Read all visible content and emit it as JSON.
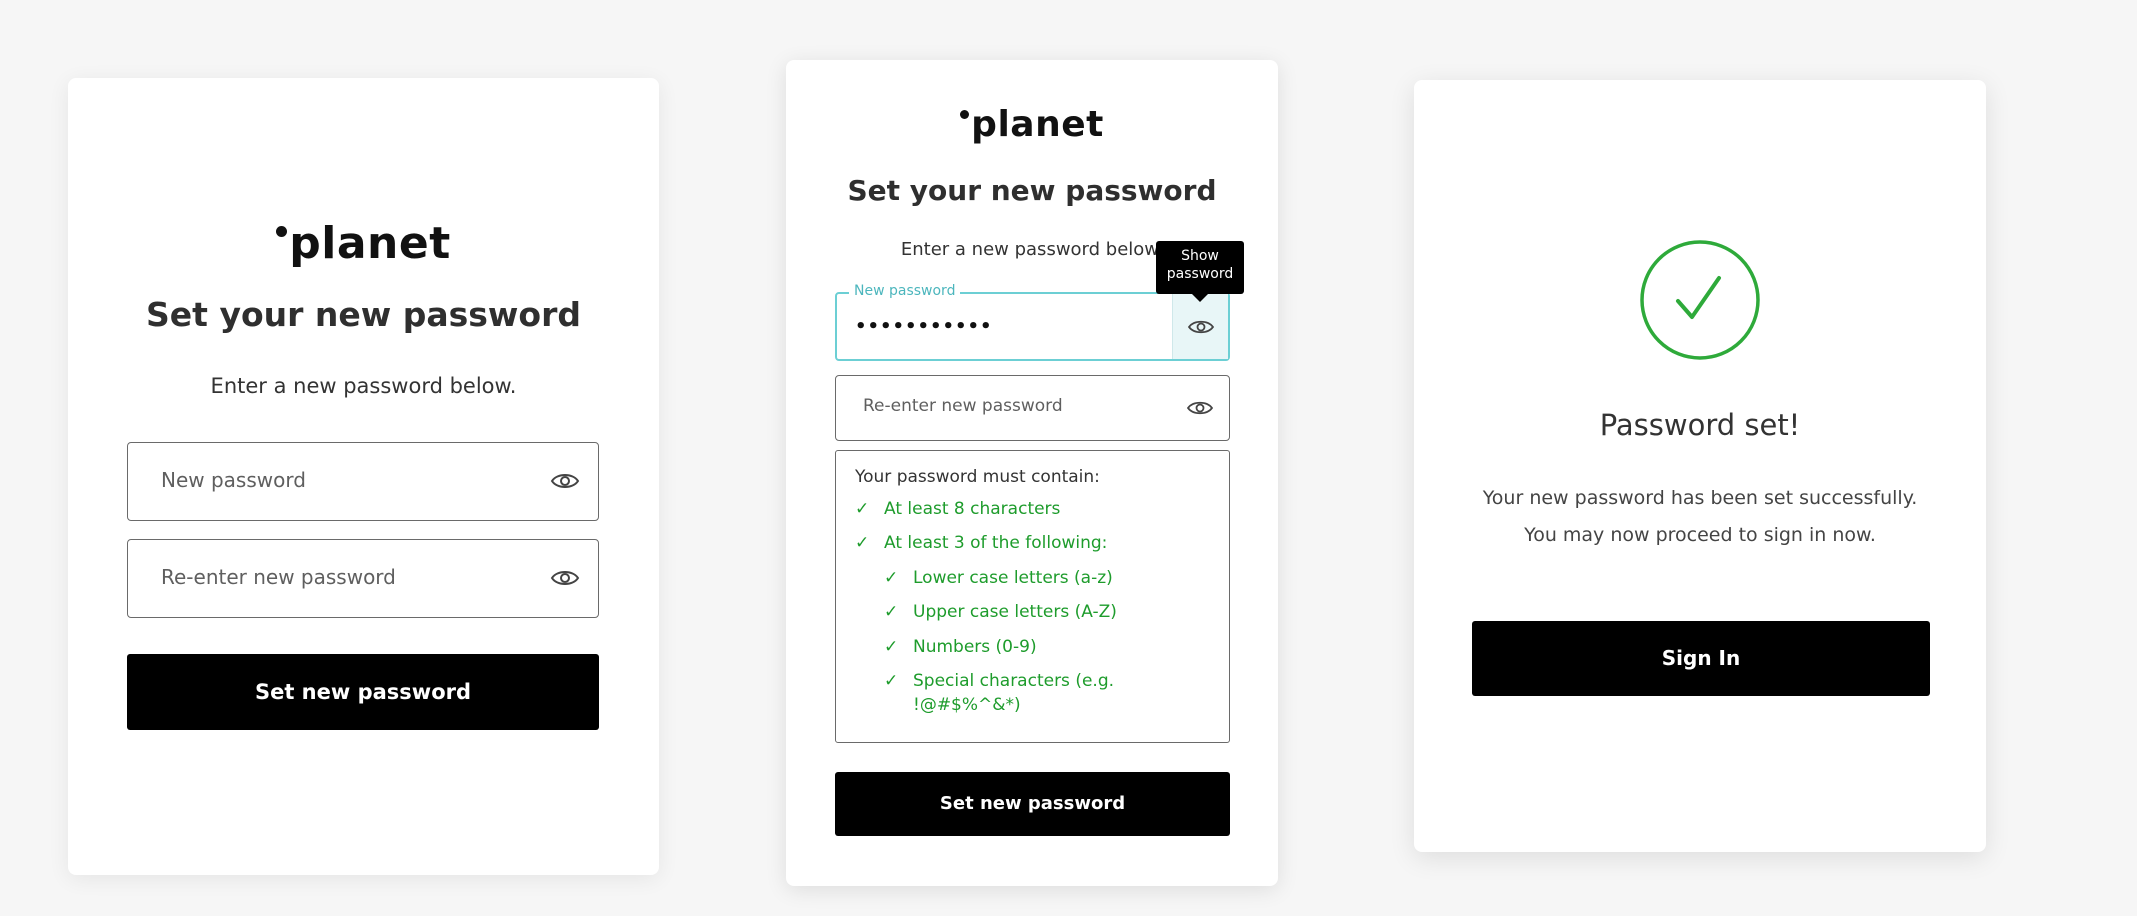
{
  "brand": {
    "logo_text": "planet"
  },
  "card1": {
    "title": "Set your new password",
    "subtitle": "Enter a new password below.",
    "new_password_placeholder": "New password",
    "reenter_password_placeholder": "Re-enter new password",
    "submit_label": "Set new password",
    "eye_icon": "eye-icon"
  },
  "card2": {
    "title": "Set your new password",
    "subtitle": "Enter a new password below.",
    "new_password_label": "New password",
    "new_password_value": "•••••••••••",
    "tooltip": "Show password",
    "reenter_password_placeholder": "Re-enter new password",
    "rules_heading": "Your password must contain:",
    "rules": [
      {
        "check": "✓",
        "text": "At least 8 characters"
      },
      {
        "check": "✓",
        "text": "At least 3 of the following:"
      },
      {
        "check": "✓",
        "text": "Lower case letters (a-z)"
      },
      {
        "check": "✓",
        "text": "Upper case letters (A-Z)"
      },
      {
        "check": "✓",
        "text": "Numbers (0-9)"
      },
      {
        "check": "✓",
        "text": "Special characters (e.g. !@#$%^&*)"
      }
    ],
    "submit_label": "Set new password",
    "valid_color": "#1e9c2c",
    "focus_color": "#6ccfd4"
  },
  "card3": {
    "success_icon": "check-circle-icon",
    "title": "Password set!",
    "message": "Your new password has been set successfully. You may now proceed to sign in now.",
    "signin_label": "Sign In",
    "success_color": "#2eaa3a"
  }
}
